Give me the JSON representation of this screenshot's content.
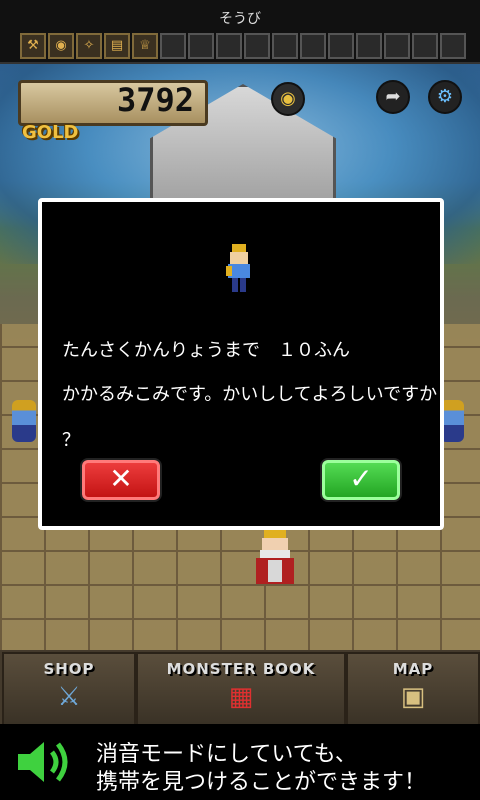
{
  "header": {
    "title": "そうび"
  },
  "equipment": [
    {
      "icon": "sword-icon",
      "glyph": "⚒",
      "filled": true
    },
    {
      "icon": "shield-icon",
      "glyph": "◉",
      "filled": true
    },
    {
      "icon": "staff-icon",
      "glyph": "✧",
      "filled": true
    },
    {
      "icon": "book-icon",
      "glyph": "▤",
      "filled": true
    },
    {
      "icon": "helmet-icon",
      "glyph": "♕",
      "filled": true
    },
    {
      "icon": "empty-slot",
      "glyph": "",
      "filled": false
    },
    {
      "icon": "empty-slot",
      "glyph": "",
      "filled": false
    },
    {
      "icon": "empty-slot",
      "glyph": "",
      "filled": false
    },
    {
      "icon": "empty-slot",
      "glyph": "",
      "filled": false
    },
    {
      "icon": "empty-slot",
      "glyph": "",
      "filled": false
    },
    {
      "icon": "empty-slot",
      "glyph": "",
      "filled": false
    },
    {
      "icon": "empty-slot",
      "glyph": "",
      "filled": false
    },
    {
      "icon": "empty-slot",
      "glyph": "",
      "filled": false
    },
    {
      "icon": "empty-slot",
      "glyph": "",
      "filled": false
    },
    {
      "icon": "empty-slot",
      "glyph": "",
      "filled": false
    },
    {
      "icon": "empty-slot",
      "glyph": "",
      "filled": false
    }
  ],
  "gold": {
    "value": "3792",
    "label": "GOLD"
  },
  "dialog": {
    "line1": "たんさくかんりょうまで　１０ふん",
    "line2": "かかるみこみです。かいししてよろしいですか",
    "line3": "？",
    "cancel": "✕",
    "confirm": "✓"
  },
  "nav": {
    "shop": "SHOP",
    "book": "MONSTER BOOK",
    "map": "MAP"
  },
  "ad": {
    "line1": "消音モードにしていても、",
    "line2": "携帯を見つけることができます！"
  },
  "colors": {
    "gold": "#f0c040",
    "cancel": "#e02828",
    "confirm": "#30c030"
  }
}
